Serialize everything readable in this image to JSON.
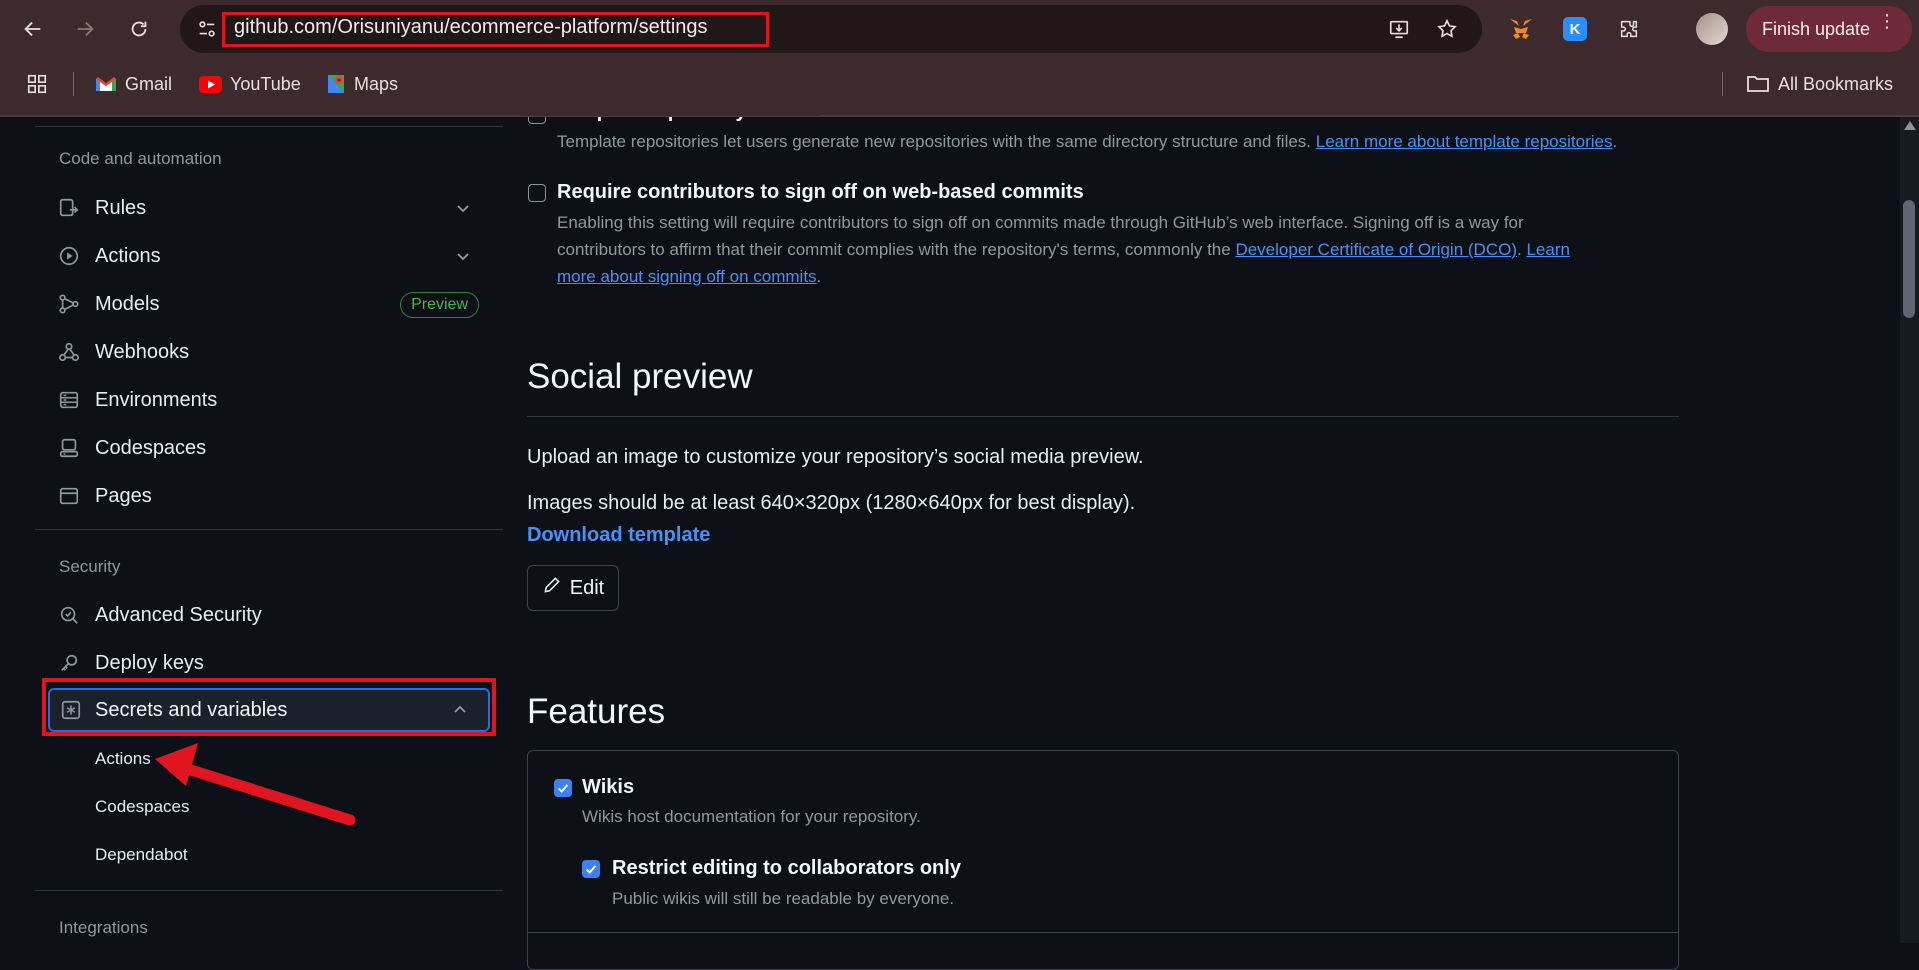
{
  "browser": {
    "url": "github.com/Orisuniyanu/ecommerce-platform/settings",
    "finish_update": "Finish update",
    "bookmarks": [
      {
        "label": "Gmail"
      },
      {
        "label": "YouTube"
      },
      {
        "label": "Maps"
      }
    ],
    "all_bookmarks": "All Bookmarks",
    "extension_k": "K"
  },
  "sidebar": {
    "code_heading": "Code and automation",
    "code_items": [
      {
        "label": "Rules"
      },
      {
        "label": "Actions"
      },
      {
        "label": "Models",
        "badge": "Preview"
      },
      {
        "label": "Webhooks"
      },
      {
        "label": "Environments"
      },
      {
        "label": "Codespaces"
      },
      {
        "label": "Pages"
      }
    ],
    "security_heading": "Security",
    "security_items": [
      {
        "label": "Advanced Security"
      },
      {
        "label": "Deploy keys"
      },
      {
        "label": "Secrets and variables"
      }
    ],
    "secrets_sub": [
      {
        "label": "Actions"
      },
      {
        "label": "Codespaces"
      },
      {
        "label": "Dependabot"
      }
    ],
    "integrations_heading": "Integrations"
  },
  "main": {
    "template_repo": {
      "title": "Template repository",
      "desc": "Template repositories let users generate new repositories with the same directory structure and files.",
      "link": "Learn more about template repositories",
      "checked": false
    },
    "signoff": {
      "title": "Require contributors to sign off on web-based commits",
      "desc_line1": "Enabling this setting will require contributors to sign off on commits made through GitHub’s web interface. Signing off is a way for",
      "desc_line2_pre": "contributors to affirm that their commit complies with the repository's terms, commonly the",
      "link_dco": "Developer Certificate of Origin (DCO)",
      "link_learn_a": "Learn",
      "link_learn_b": "more about signing off on commits",
      "checked": false
    },
    "social_preview": {
      "heading": "Social preview",
      "desc": "Upload an image to customize your repository’s social media preview.",
      "size_note": "Images should be at least 640×320px (1280×640px for best display).",
      "download": "Download template",
      "edit": "Edit"
    },
    "features": {
      "heading": "Features",
      "wikis_title": "Wikis",
      "wikis_desc": "Wikis host documentation for your repository.",
      "wikis_checked": true,
      "restrict_title": "Restrict editing to collaborators only",
      "restrict_desc": "Public wikis will still be readable by everyone.",
      "restrict_checked": true
    }
  },
  "colors": {
    "annotation_red": "#e0151f",
    "link_blue": "#4493f8",
    "active_border": "#1f6feb"
  }
}
